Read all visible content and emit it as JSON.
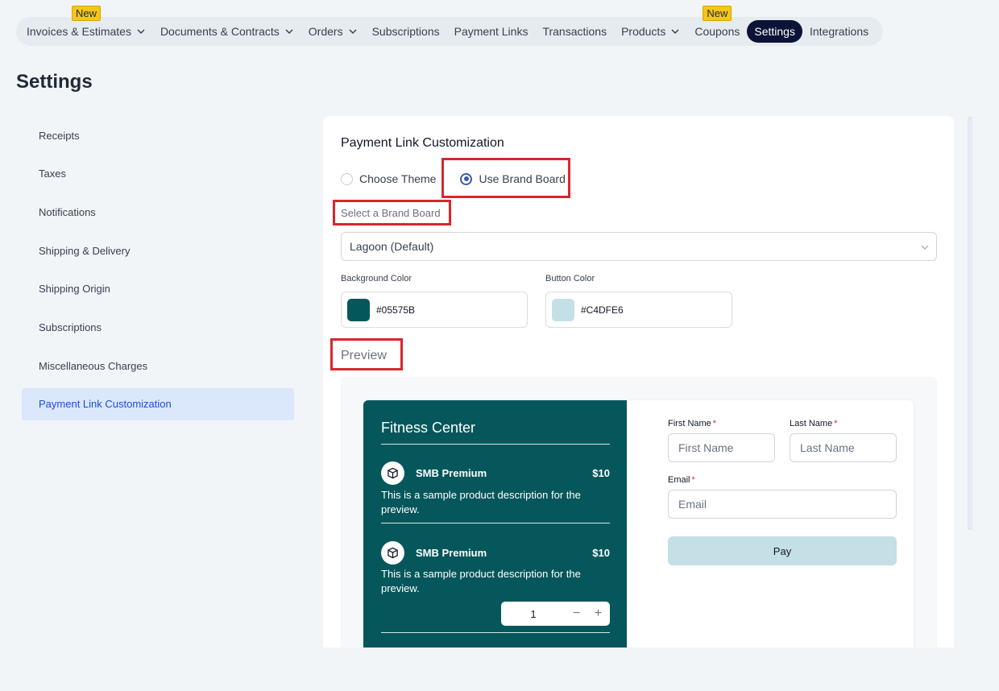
{
  "nav": {
    "items": [
      {
        "label": "Invoices & Estimates",
        "has_chevron": true,
        "badge": "New"
      },
      {
        "label": "Documents & Contracts",
        "has_chevron": true
      },
      {
        "label": "Orders",
        "has_chevron": true
      },
      {
        "label": "Subscriptions"
      },
      {
        "label": "Payment Links"
      },
      {
        "label": "Transactions"
      },
      {
        "label": "Products",
        "has_chevron": true
      },
      {
        "label": "Coupons",
        "badge": "New"
      },
      {
        "label": "Settings",
        "active": true
      },
      {
        "label": "Integrations"
      }
    ]
  },
  "page": {
    "title": "Settings"
  },
  "sidebar": {
    "items": [
      {
        "label": "Receipts"
      },
      {
        "label": "Taxes"
      },
      {
        "label": "Notifications"
      },
      {
        "label": "Shipping & Delivery"
      },
      {
        "label": "Shipping Origin"
      },
      {
        "label": "Subscriptions"
      },
      {
        "label": "Miscellaneous Charges"
      },
      {
        "label": "Payment Link Customization",
        "active": true
      }
    ]
  },
  "panel": {
    "title": "Payment Link Customization",
    "radio_theme": "Choose Theme",
    "radio_brand": "Use Brand Board",
    "selected": "brand",
    "brand_board_label": "Select a Brand Board",
    "brand_board_value": "Lagoon (Default)",
    "bg_color_label": "Background Color",
    "bg_color_value": "#05575B",
    "button_color_label": "Button Color",
    "button_color_value": "#C4DFE6",
    "preview_heading": "Preview"
  },
  "preview": {
    "business_name": "Fitness Center",
    "products": [
      {
        "name": "SMB Premium",
        "price": "$10",
        "description": "This is a sample product description for the preview."
      },
      {
        "name": "SMB Premium",
        "price": "$10",
        "description": "This is a sample product description for the preview.",
        "quantity": "1"
      }
    ],
    "first_name_label": "First Name",
    "first_name_placeholder": "First Name",
    "last_name_label": "Last Name",
    "last_name_placeholder": "Last Name",
    "email_label": "Email",
    "email_placeholder": "Email",
    "required_mark": "*",
    "pay_label": "Pay",
    "qty_minus": "−",
    "qty_plus": "+"
  },
  "colors": {
    "nav_active": "#0b1437",
    "highlight": "#d9262e",
    "badge": "#f5c518",
    "preview_bg": "#05575B",
    "preview_button": "#C4DFE6",
    "sidebar_active": "#dbe7fb"
  },
  "icons": {
    "chevron": "chevron-down-icon",
    "product": "cube-icon"
  }
}
